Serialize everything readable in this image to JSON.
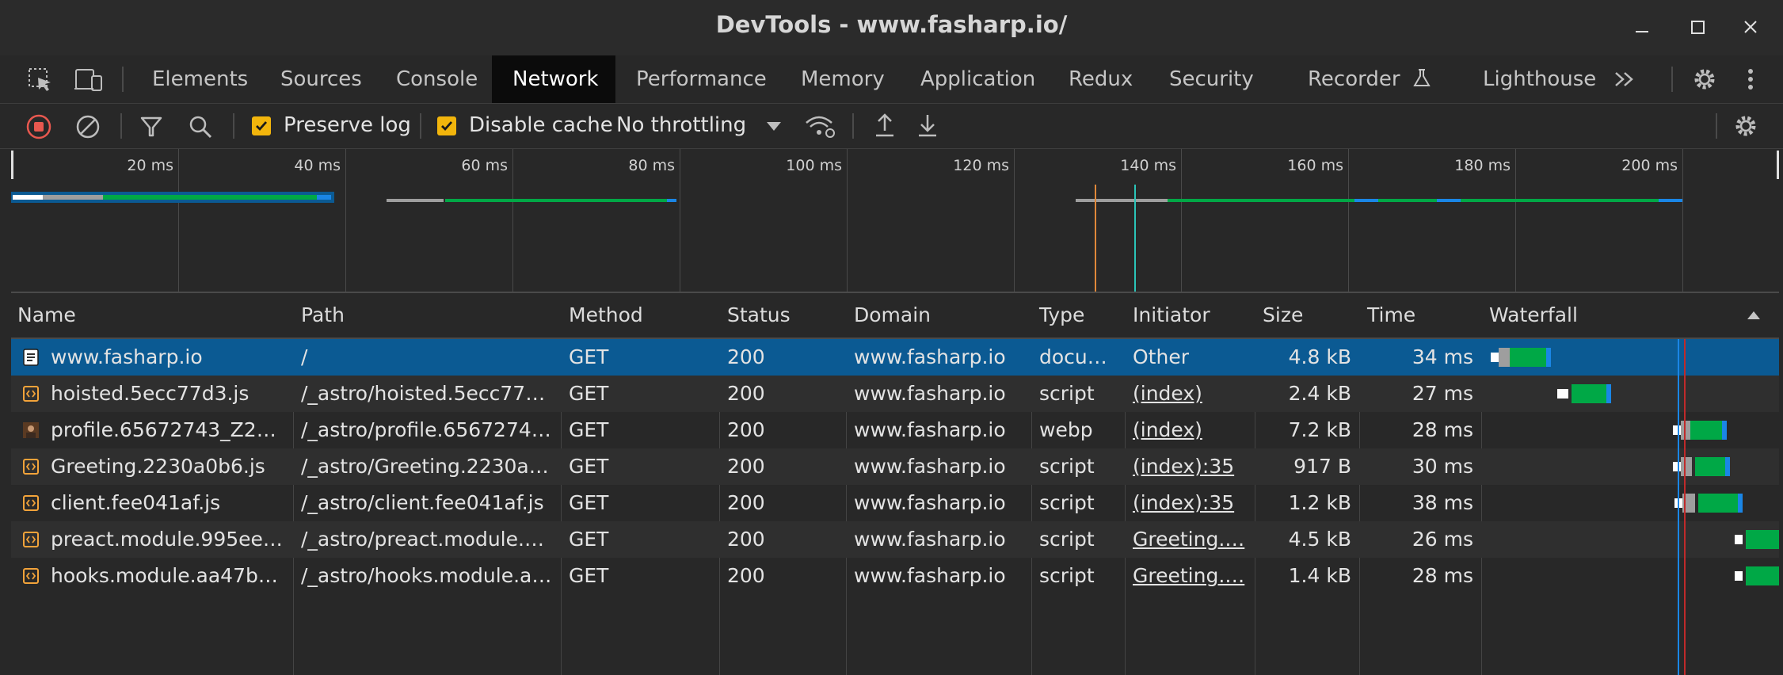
{
  "window": {
    "title": "DevTools - www.fasharp.io/",
    "minimize_icon": "minimize-icon",
    "maximize_icon": "maximize-icon",
    "close_icon": "close-icon"
  },
  "tabs": [
    {
      "label": "Elements"
    },
    {
      "label": "Sources"
    },
    {
      "label": "Console"
    },
    {
      "label": "Network",
      "active": true
    },
    {
      "label": "Performance"
    },
    {
      "label": "Memory"
    },
    {
      "label": "Application"
    },
    {
      "label": "Redux"
    },
    {
      "label": "Security"
    },
    {
      "label": "Recorder"
    },
    {
      "label": "Lighthouse"
    }
  ],
  "toolbar": {
    "preserve_log": {
      "label": "Preserve log",
      "checked": true
    },
    "disable_cache": {
      "label": "Disable cache",
      "checked": true
    },
    "throttling": "No throttling"
  },
  "overview": {
    "ticks": [
      "20 ms",
      "40 ms",
      "60 ms",
      "80 ms",
      "100 ms",
      "120 ms",
      "140 ms",
      "160 ms",
      "180 ms",
      "200 ms"
    ]
  },
  "columns": [
    "Name",
    "Path",
    "Method",
    "Status",
    "Domain",
    "Type",
    "Initiator",
    "Size",
    "Time",
    "Waterfall"
  ],
  "rows": [
    {
      "name": "www.fasharp.io",
      "path": "/",
      "method": "GET",
      "status": "200",
      "domain": "www.fasharp.io",
      "type": "docu…",
      "initiator": "Other",
      "initiator_link": false,
      "size": "4.8 kB",
      "time": "34 ms",
      "icon": "document-icon",
      "selected": true
    },
    {
      "name": "hoisted.5ecc77d3.js",
      "path": "/_astro/hoisted.5ecc77d…",
      "method": "GET",
      "status": "200",
      "domain": "www.fasharp.io",
      "type": "script",
      "initiator": "(index)",
      "initiator_link": true,
      "size": "2.4 kB",
      "time": "27 ms",
      "icon": "script-icon"
    },
    {
      "name": "profile.65672743_Z2d…",
      "path": "/_astro/profile.6567274…",
      "method": "GET",
      "status": "200",
      "domain": "www.fasharp.io",
      "type": "webp",
      "initiator": "(index)",
      "initiator_link": true,
      "size": "7.2 kB",
      "time": "28 ms",
      "icon": "image-icon"
    },
    {
      "name": "Greeting.2230a0b6.js",
      "path": "/_astro/Greeting.2230a…",
      "method": "GET",
      "status": "200",
      "domain": "www.fasharp.io",
      "type": "script",
      "initiator": "(index):35",
      "initiator_link": true,
      "size": "917 B",
      "time": "30 ms",
      "icon": "script-icon"
    },
    {
      "name": "client.fee041af.js",
      "path": "/_astro/client.fee041af.js",
      "method": "GET",
      "status": "200",
      "domain": "www.fasharp.io",
      "type": "script",
      "initiator": "(index):35",
      "initiator_link": true,
      "size": "1.2 kB",
      "time": "38 ms",
      "icon": "script-icon"
    },
    {
      "name": "preact.module.995ee…",
      "path": "/_astro/preact.module.9…",
      "method": "GET",
      "status": "200",
      "domain": "www.fasharp.io",
      "type": "script",
      "initiator": "Greeting.…",
      "initiator_link": true,
      "size": "4.5 kB",
      "time": "26 ms",
      "icon": "script-icon"
    },
    {
      "name": "hooks.module.aa47bc…",
      "path": "/_astro/hooks.module.a…",
      "method": "GET",
      "status": "200",
      "domain": "www.fasharp.io",
      "type": "script",
      "initiator": "Greeting.…",
      "initiator_link": true,
      "size": "1.4 kB",
      "time": "28 ms",
      "icon": "script-icon"
    }
  ],
  "colors": {
    "selected_row": "#0b5a93",
    "waterfall_green": "#00a846",
    "waterfall_blue": "#1a86e6",
    "waiting_gray": "#9e9e9e",
    "checkbox": "#f2b50c",
    "record_red": "#e8584f"
  }
}
